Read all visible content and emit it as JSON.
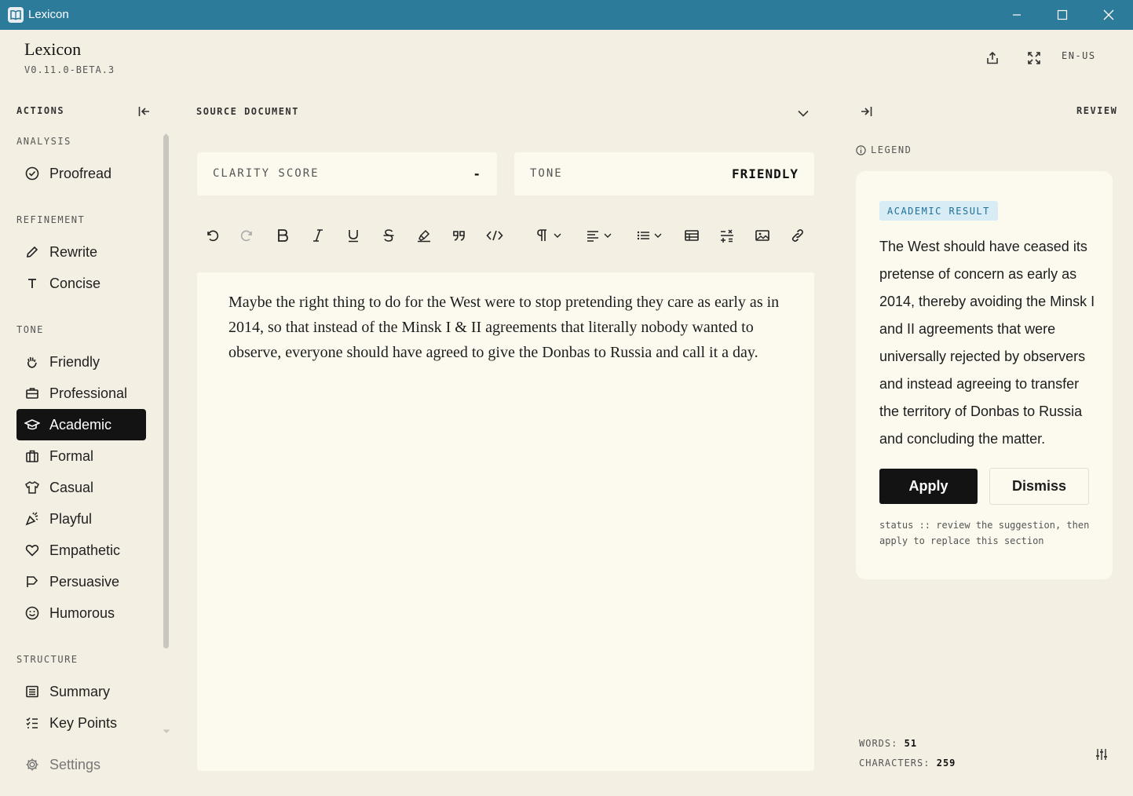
{
  "window": {
    "title": "Lexicon"
  },
  "brand": {
    "name": "Lexicon",
    "version": "V0.11.0-BETA.3",
    "language": "EN-US"
  },
  "sidebar": {
    "heading": "ACTIONS",
    "sections": {
      "analysis": "ANALYSIS",
      "refinement": "REFINEMENT",
      "tone": "TONE",
      "structure": "STRUCTURE"
    },
    "items": {
      "proofread": "Proofread",
      "rewrite": "Rewrite",
      "concise": "Concise",
      "friendly": "Friendly",
      "professional": "Professional",
      "academic": "Academic",
      "formal": "Formal",
      "casual": "Casual",
      "playful": "Playful",
      "empathetic": "Empathetic",
      "persuasive": "Persuasive",
      "humorous": "Humorous",
      "summary": "Summary",
      "key_points": "Key Points",
      "settings": "Settings"
    },
    "active_item": "Academic"
  },
  "main": {
    "heading": "SOURCE DOCUMENT",
    "clarity": {
      "label": "CLARITY SCORE",
      "value": "-"
    },
    "tone": {
      "label": "TONE",
      "value": "FRIENDLY"
    },
    "document_text": "Maybe the right thing to do for the West were to stop pretending they care as early as in 2014, so that instead of the Minsk I & II agreements that literally nobody wanted to observe, everyone should have agreed to give the Donbas to Russia and call it a day."
  },
  "review": {
    "heading": "REVIEW",
    "legend": "LEGEND",
    "badge": "ACADEMIC RESULT",
    "result_text": "The West should have ceased its pretense of concern as early as 2014, thereby avoiding the Minsk I and II agreements that were universally rejected by observers and instead agreeing to transfer the territory of Donbas to Russia and concluding the matter.",
    "apply_label": "Apply",
    "dismiss_label": "Dismiss",
    "status": "status :: review the suggestion, then apply to replace this section"
  },
  "counts": {
    "words_label": "WORDS:",
    "words": "51",
    "chars_label": "CHARACTERS:",
    "chars": "259"
  },
  "colors": {
    "titlebar": "#2d7b9a",
    "background": "#f4efe3",
    "card": "#fcf9ee",
    "active": "#131313",
    "badge_bg": "#d8ecf6",
    "badge_text": "#1e6f95"
  }
}
